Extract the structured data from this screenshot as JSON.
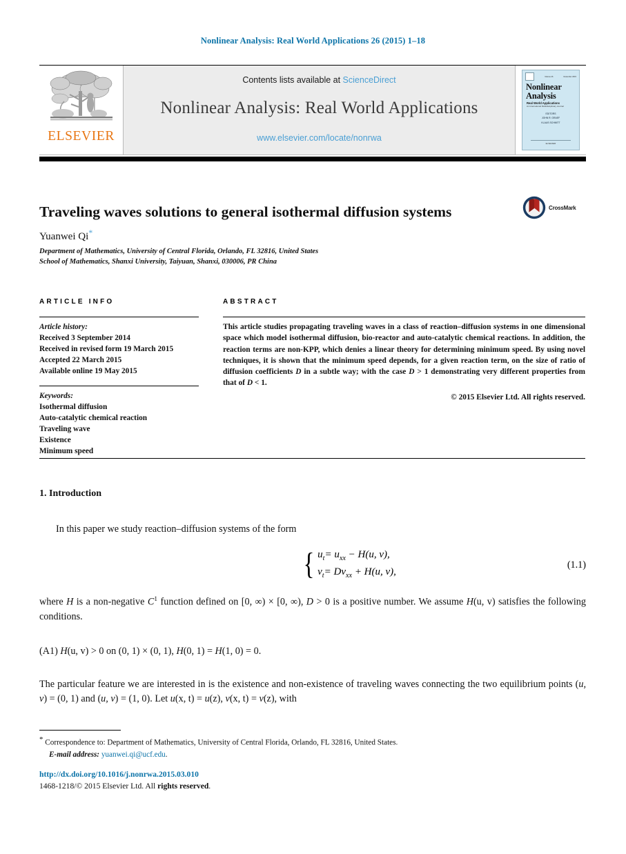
{
  "running_head": "Nonlinear Analysis: Real World Applications 26 (2015) 1–18",
  "masthead": {
    "publisher_name": "ELSEVIER",
    "contents_prefix": "Contents lists available at ",
    "sciencedirect": "ScienceDirect",
    "journal_title": "Nonlinear Analysis: Real World Applications",
    "journal_url": "www.elsevier.com/locate/nonrwa",
    "cover": {
      "line1": "Nonlinear",
      "line2": "Analysis",
      "subtitle": "Real World Applications",
      "subtitle2": "An International Multidisciplinary Journal",
      "editors": [
        "EDITORS",
        "JOHN R. GRAEF",
        "KLAUS SCHMITT"
      ],
      "footer": "ELSEVIER",
      "issn_left": "ISSN 1468-1218",
      "volume": "Volume 26",
      "date": "December 2015"
    }
  },
  "article": {
    "title": "Traveling waves solutions to general isothermal diffusion systems",
    "crossmark_label": "CrossMark",
    "author": "Yuanwei Qi",
    "author_marker": "*",
    "affiliations": [
      "Department of Mathematics, University of Central Florida, Orlando, FL 32816, United States",
      "School of Mathematics, Shanxi University, Taiyuan, Shanxi, 030006, PR China"
    ]
  },
  "article_info": {
    "heading": "ARTICLE INFO",
    "history_label": "Article history:",
    "history": [
      "Received 3 September 2014",
      "Received in revised form 19 March 2015",
      "Accepted 22 March 2015",
      "Available online 19 May 2015"
    ],
    "keywords_label": "Keywords:",
    "keywords": [
      "Isothermal diffusion",
      "Auto-catalytic chemical reaction",
      "Traveling wave",
      "Existence",
      "Minimum speed"
    ]
  },
  "abstract": {
    "heading": "ABSTRACT",
    "text_part1": "This article studies propagating traveling waves in a class of reaction–diffusion systems in one dimensional space which model isothermal diffusion, bio-reactor and auto-catalytic chemical reactions. In addition, the reaction terms are non-KPP, which denies a linear theory for determining minimum speed. By using novel techniques, it is shown that the minimum speed depends, for a given reaction term, on the size of ratio of diffusion coefficients ",
    "sym_D_1": "D",
    "text_part2": " in a subtle way; with the case ",
    "sym_D_2": "D",
    "text_part3": " > 1 demonstrating very different properties from that of ",
    "sym_D_3": "D",
    "text_part4": " < 1.",
    "copyright": "© 2015 Elsevier Ltd. All rights reserved."
  },
  "body": {
    "section_heading": "1. Introduction",
    "intro_paragraph": "In this paper we study reaction–diffusion systems of the form",
    "equation": {
      "number": "(1.1)",
      "line1_lhs": "u",
      "line1_lhs_sub": "t",
      "line1_rhs": "= u",
      "line1_rhs_sub": "xx",
      "line1_tail": " − H(u, v),",
      "line2_lhs": "v",
      "line2_lhs_sub": "t",
      "line2_rhs": "= Dv",
      "line2_rhs_sub": "xx",
      "line2_tail": " + H(u, v),"
    },
    "paragraph_where_a": "where ",
    "paragraph_where_H": "H",
    "paragraph_where_b": " is a non-negative ",
    "paragraph_where_C": "C",
    "paragraph_where_C_sup": "1",
    "paragraph_where_c": " function defined on [0, ∞) × [0, ∞), ",
    "paragraph_where_D": "D",
    "paragraph_where_d": " > 0 is a positive number. We assume ",
    "paragraph_where_Huv": "H",
    "paragraph_where_e": "(u, v) satisfies the following conditions.",
    "assumption_a1_tag": "(A1)",
    "assumption_a1_H1": "H",
    "assumption_a1_text1": "(u, v) > 0 on (0, 1) × (0, 1), ",
    "assumption_a1_H2": "H",
    "assumption_a1_text2": "(0, 1) = ",
    "assumption_a1_H3": "H",
    "assumption_a1_text3": "(1, 0) = 0.",
    "paragraph_feature_a": "The particular feature we are interested in is the existence and non-existence of traveling waves connecting the two equilibrium points (",
    "paragraph_feature_uv1": "u, v",
    "paragraph_feature_b": ") = (0, 1) and (",
    "paragraph_feature_uv2": "u, v",
    "paragraph_feature_c": ") = (1, 0). Let ",
    "paragraph_feature_uxt": "u",
    "paragraph_feature_d": "(x, t) = ",
    "paragraph_feature_uz": "u",
    "paragraph_feature_e": "(z), ",
    "paragraph_feature_vxt": "v",
    "paragraph_feature_f": "(x, t) = ",
    "paragraph_feature_vz": "v",
    "paragraph_feature_g": "(z), with"
  },
  "footer": {
    "corr_marker": "*",
    "correspondence": " Correspondence to: Department of Mathematics, University of Central Florida, Orlando, FL 32816, United States.",
    "email_label": "E-mail address:",
    "email": "yuanwei.qi@ucf.edu",
    "email_period": ".",
    "doi": "http://dx.doi.org/10.1016/j.nonrwa.2015.03.010",
    "issn_prefix": "1468-1218/",
    "issn_copyright": "© 2015 Elsevier Ltd. All ",
    "issn_bold": "rights reserved",
    "issn_suffix": "."
  },
  "colors": {
    "link_blue": "#0b73a8",
    "sciencedirect_blue": "#4a9fd4",
    "elsevier_orange": "#e87613",
    "banner_grey": "#ececec",
    "cover_blue": "#cfe7f2"
  }
}
